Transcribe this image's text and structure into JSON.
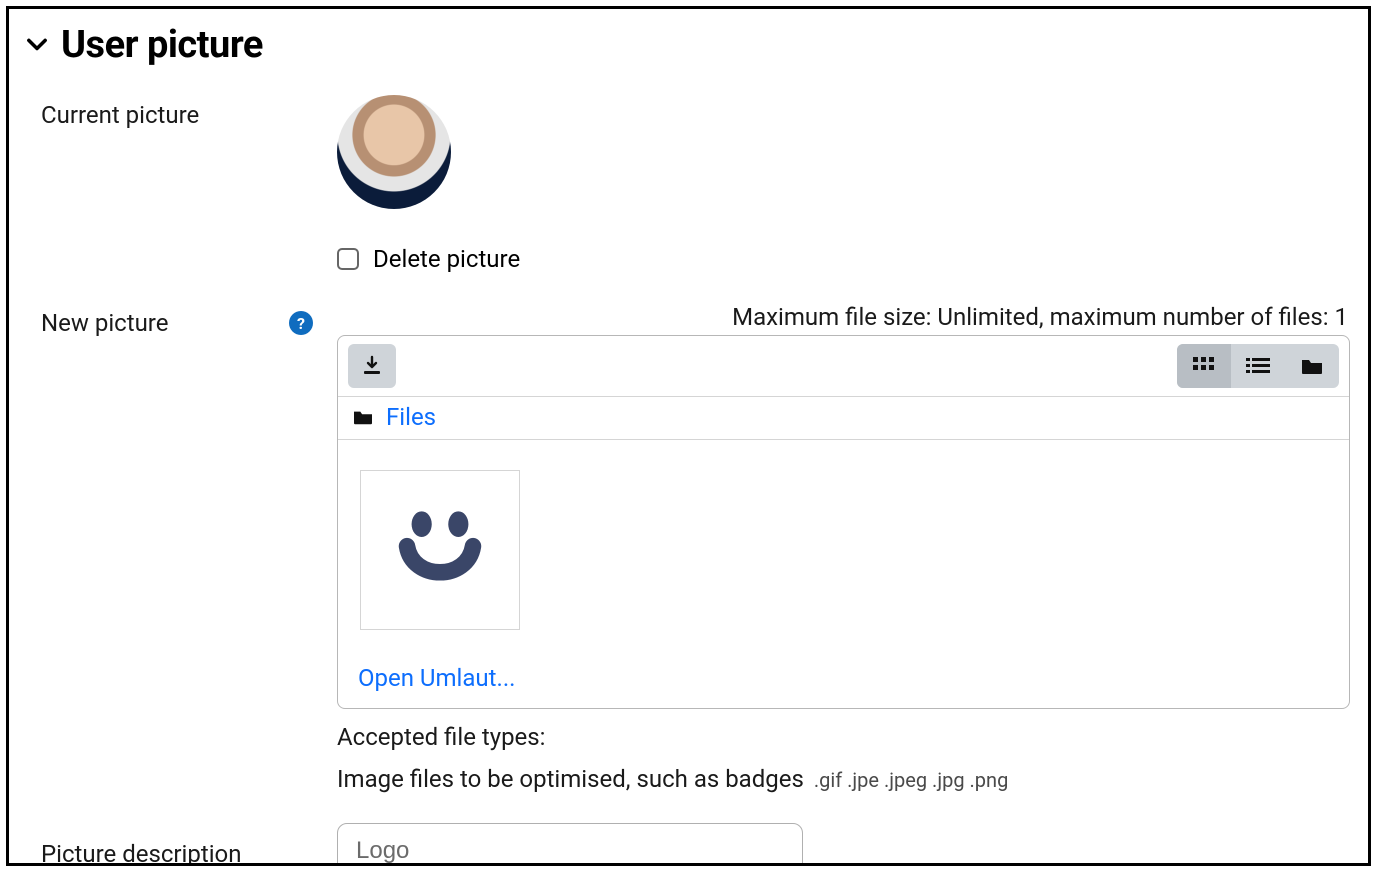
{
  "section": {
    "title": "User picture"
  },
  "currentPicture": {
    "label": "Current picture",
    "deleteLabel": "Delete picture"
  },
  "newPicture": {
    "label": "New picture",
    "limitText": "Maximum file size: Unlimited, maximum number of files: 1",
    "pathRoot": "Files",
    "fileName": "Open Umlaut...",
    "acceptedLabel": "Accepted file types:",
    "acceptedDetail": "Image files to be optimised, such as badges",
    "acceptedExt": ".gif .jpe .jpeg .jpg .png"
  },
  "description": {
    "label": "Picture description",
    "value": "Logo"
  }
}
